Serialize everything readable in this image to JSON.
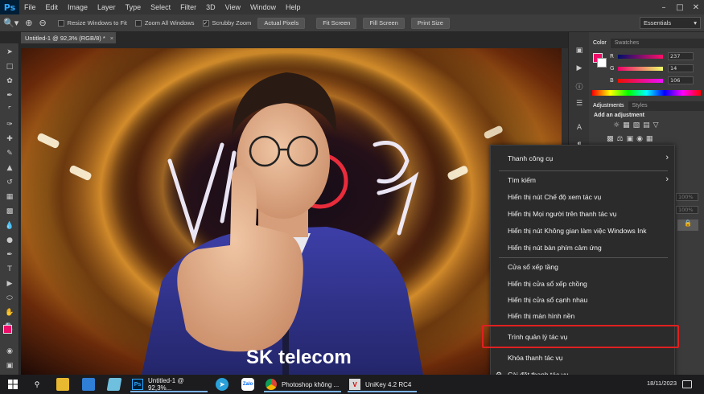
{
  "menubar": {
    "logo": "Ps",
    "items": [
      "File",
      "Edit",
      "Image",
      "Layer",
      "Type",
      "Select",
      "Filter",
      "3D",
      "View",
      "Window",
      "Help"
    ],
    "window_controls": [
      "–",
      "□",
      "✕"
    ]
  },
  "options_bar": {
    "checkboxes": [
      {
        "label": "Resize Windows to Fit",
        "checked": false
      },
      {
        "label": "Zoom All Windows",
        "checked": false
      },
      {
        "label": "Scrubby Zoom",
        "checked": true
      }
    ],
    "buttons": [
      "Actual Pixels",
      "Fit Screen",
      "Fill Screen",
      "Print Size"
    ],
    "workspace": "Essentials"
  },
  "document": {
    "tab_title": "Untitled-1 @ 92,3% (RGB/8) *",
    "close": "×"
  },
  "panels": {
    "color_tabs": [
      "Color",
      "Swatches"
    ],
    "rgb": [
      {
        "label": "R",
        "value": "237"
      },
      {
        "label": "G",
        "value": "14"
      },
      {
        "label": "B",
        "value": "106"
      }
    ],
    "foreground_color": "#ed0e6a",
    "adjust_tabs": [
      "Adjustments",
      "Styles"
    ],
    "adjust_heading": "Add an adjustment",
    "layers_partial": [
      "100%",
      "100%"
    ]
  },
  "context_menu": {
    "items": [
      {
        "label": "Thanh công cụ",
        "submenu": true
      },
      {
        "label": "Tìm kiếm",
        "submenu": true
      },
      {
        "label": "Hiển thị nút Chế độ xem tác vụ"
      },
      {
        "label": "Hiển thị Mọi người trên thanh tác vụ"
      },
      {
        "label": "Hiển thị nút Không gian làm việc Windows Ink"
      },
      {
        "label": "Hiển thị nút bàn phím cảm ứng"
      },
      {
        "label": "Cửa sổ xếp tầng"
      },
      {
        "label": "Hiển thị cửa sổ xếp chồng"
      },
      {
        "label": "Hiển thị cửa sổ cạnh nhau"
      },
      {
        "label": "Hiển thị màn hình nền"
      },
      {
        "label": "Trình quản lý tác vụ",
        "highlighted": true
      },
      {
        "label": "Khóa thanh tác vụ"
      },
      {
        "label": "Cài đặt thanh tác vụ",
        "icon": "gear-icon"
      }
    ]
  },
  "taskbar": {
    "apps": [
      {
        "label": "Untitled-1 @ 92,3%...",
        "icon": "Ps"
      },
      {
        "label": "Photoshop không ...",
        "icon": "chrome"
      },
      {
        "label": "UniKey 4.2 RC4",
        "icon": "unikey"
      }
    ],
    "zalo_label": "Zalo",
    "date": "18/11/2023"
  }
}
